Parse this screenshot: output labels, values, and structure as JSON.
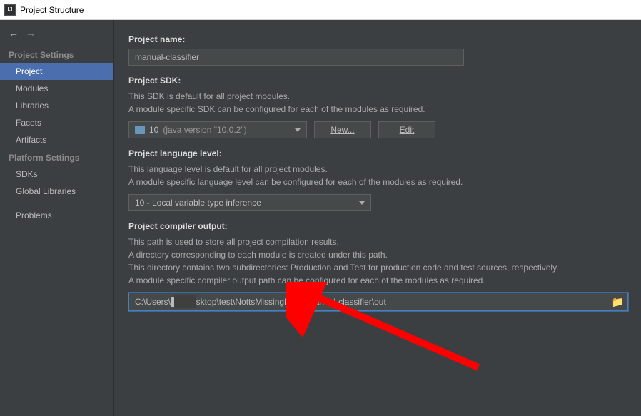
{
  "titlebar": {
    "icon_label": "IJ",
    "title": "Project Structure"
  },
  "sidebar": {
    "heading1": "Project Settings",
    "heading2": "Platform Settings",
    "items1": [
      "Project",
      "Modules",
      "Libraries",
      "Facets",
      "Artifacts"
    ],
    "items2": [
      "SDKs",
      "Global Libraries"
    ],
    "problems": "Problems"
  },
  "main": {
    "project_name_label": "Project name:",
    "project_name_value": "manual-classifier",
    "sdk_label": "Project SDK:",
    "sdk_desc1": "This SDK is default for all project modules.",
    "sdk_desc2": "A module specific SDK can be configured for each of the modules as required.",
    "sdk_selected_num": "10",
    "sdk_selected_ver": "(java version \"10.0.2\")",
    "new_button": "New...",
    "edit_button": "Edit",
    "lang_label": "Project language level:",
    "lang_desc1": "This language level is default for all project modules.",
    "lang_desc2": "A module specific language level can be configured for each of the modules as required.",
    "lang_selected": "10 - Local variable type inference",
    "output_label": "Project compiler output:",
    "output_desc1": "This path is used to store all project compilation results.",
    "output_desc2": "A directory corresponding to each module is created under this path.",
    "output_desc3": "This directory contains two subdirectories: Production and Test for production code and test sources, respectively.",
    "output_desc4": "A module specific compiler output path can be configured for each of the modules as required.",
    "output_value": "C:\\Users\\██\\Desktop\\test\\NottsMissingMaps\\manual-classifier\\out"
  }
}
